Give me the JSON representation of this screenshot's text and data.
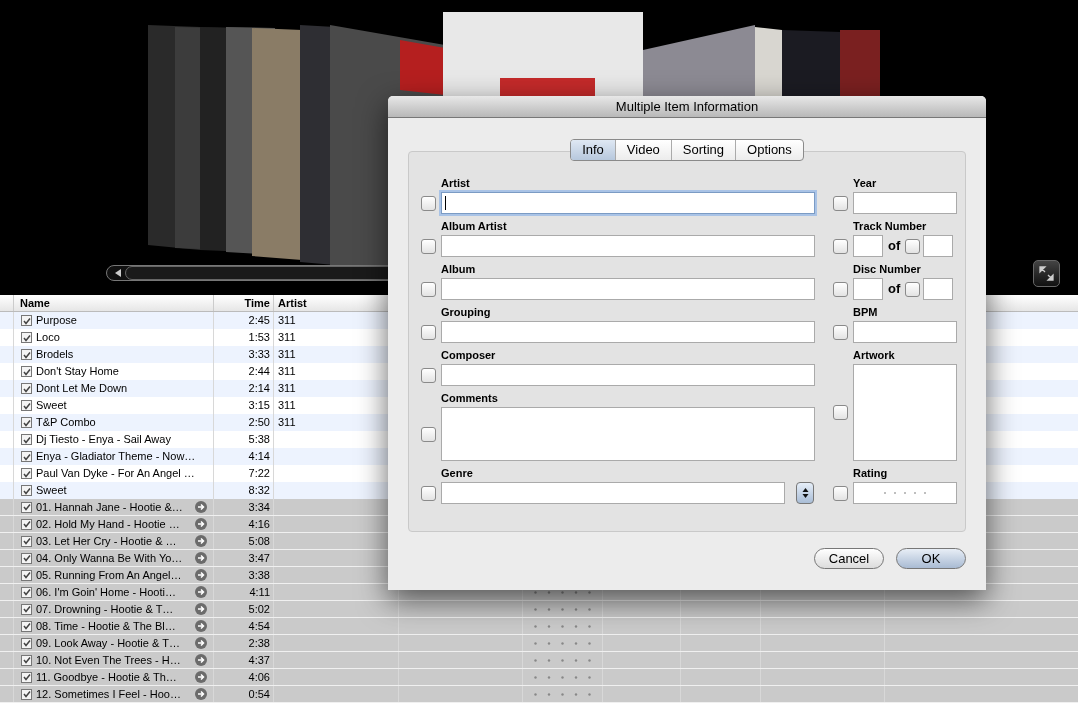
{
  "table": {
    "columns": [
      {
        "label": "Name"
      },
      {
        "label": "Time"
      },
      {
        "label": "Artist"
      }
    ],
    "rows": [
      {
        "name": "Purpose",
        "time": "2:45",
        "artist": "311",
        "checked": true,
        "selected": false
      },
      {
        "name": "Loco",
        "time": "1:53",
        "artist": "311",
        "checked": true,
        "selected": false
      },
      {
        "name": "Brodels",
        "time": "3:33",
        "artist": "311",
        "checked": true,
        "selected": false
      },
      {
        "name": "Don't Stay Home",
        "time": "2:44",
        "artist": "311",
        "checked": true,
        "selected": false
      },
      {
        "name": "Dont Let Me Down",
        "time": "2:14",
        "artist": "311",
        "checked": true,
        "selected": false
      },
      {
        "name": "Sweet",
        "time": "3:15",
        "artist": "311",
        "checked": true,
        "selected": false
      },
      {
        "name": "T&P Combo",
        "time": "2:50",
        "artist": "311",
        "checked": true,
        "selected": false
      },
      {
        "name": "Dj Tiesto - Enya - Sail Away",
        "time": "5:38",
        "checked": true,
        "selected": false
      },
      {
        "name": "Enya - Gladiator Theme - Now…",
        "time": "4:14",
        "checked": true,
        "selected": false
      },
      {
        "name": "Paul Van Dyke - For An Angel …",
        "time": "7:22",
        "checked": true,
        "selected": false
      },
      {
        "name": "Sweet",
        "time": "8:32",
        "checked": true,
        "selected": false
      },
      {
        "name": "01. Hannah Jane - Hootie &…",
        "time": "3:34",
        "checked": true,
        "selected": true
      },
      {
        "name": "02. Hold My Hand - Hootie …",
        "time": "4:16",
        "checked": true,
        "selected": true
      },
      {
        "name": "03. Let Her Cry - Hootie & …",
        "time": "5:08",
        "checked": true,
        "selected": true
      },
      {
        "name": "04. Only Wanna Be With Yo…",
        "time": "3:47",
        "checked": true,
        "selected": true
      },
      {
        "name": "05. Running From An Angel…",
        "time": "3:38",
        "checked": true,
        "selected": true
      },
      {
        "name": "06. I'm Goin' Home - Hooti…",
        "time": "4:11",
        "checked": true,
        "selected": true
      },
      {
        "name": "07. Drowning - Hootie & T…",
        "time": "5:02",
        "checked": true,
        "selected": true
      },
      {
        "name": "08. Time - Hootie & The Bl…",
        "time": "4:54",
        "checked": true,
        "selected": true
      },
      {
        "name": "09. Look Away - Hootie & T…",
        "time": "2:38",
        "checked": true,
        "selected": true
      },
      {
        "name": "10. Not Even The Trees - H…",
        "time": "4:37",
        "checked": true,
        "selected": true
      },
      {
        "name": "11. Goodbye - Hootie & Th…",
        "time": "4:06",
        "checked": true,
        "selected": true
      },
      {
        "name": "12. Sometimes I Feel - Hoo…",
        "time": "0:54",
        "checked": true,
        "selected": true
      }
    ]
  },
  "dialog": {
    "title": "Multiple Item Information",
    "tabs": [
      {
        "label": "Info",
        "selected": true
      },
      {
        "label": "Video",
        "selected": false
      },
      {
        "label": "Sorting",
        "selected": false
      },
      {
        "label": "Options",
        "selected": false
      }
    ],
    "left_fields": [
      {
        "label": "Artist",
        "kind": "text",
        "checked": false,
        "focused": true
      },
      {
        "label": "Album Artist",
        "kind": "text",
        "checked": false,
        "focused": false
      },
      {
        "label": "Album",
        "kind": "text",
        "checked": false,
        "focused": false
      },
      {
        "label": "Grouping",
        "kind": "text",
        "checked": false,
        "focused": false
      },
      {
        "label": "Composer",
        "kind": "text",
        "checked": false,
        "focused": false
      },
      {
        "label": "Comments",
        "kind": "textarea",
        "checked": false,
        "focused": false
      },
      {
        "label": "Genre",
        "kind": "combo",
        "checked": false,
        "focused": false
      }
    ],
    "right_fields": [
      {
        "label": "Year",
        "kind": "text",
        "checked": false
      },
      {
        "label": "Track Number",
        "kind": "pair",
        "checked": false,
        "of_label": "of",
        "of_checked": false
      },
      {
        "label": "Disc Number",
        "kind": "pair",
        "checked": false,
        "of_label": "of",
        "of_checked": false
      },
      {
        "label": "BPM",
        "kind": "text",
        "checked": false
      },
      {
        "label": "Artwork",
        "kind": "artwork",
        "checked": false
      },
      {
        "label": "Rating",
        "kind": "rating",
        "checked": false,
        "stars": 0
      }
    ],
    "buttons": [
      {
        "label": "Cancel",
        "default": false
      },
      {
        "label": "OK",
        "default": true
      }
    ]
  }
}
